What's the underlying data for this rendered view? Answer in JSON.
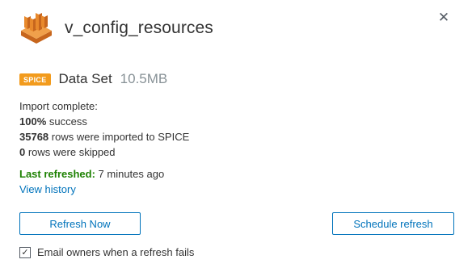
{
  "header": {
    "title": "v_config_resources",
    "close_symbol": "✕",
    "logo_icon": "quicksight-bars-icon",
    "logo_color": "#e8892c"
  },
  "dataset": {
    "badge": "SPICE",
    "badge_color": "#f29b1d",
    "label": "Data Set",
    "size": "10.5MB"
  },
  "status": {
    "import_line": "Import complete:",
    "success_value": "100%",
    "success_text": " success",
    "rows_imported_value": "35768",
    "rows_imported_text": " rows were imported to SPICE",
    "rows_skipped_value": "0",
    "rows_skipped_text": " rows were skipped"
  },
  "refresh": {
    "last_refreshed_label": "Last refreshed:",
    "last_refreshed_value": " 7 minutes ago",
    "view_history": "View history",
    "success_color": "#1d8102",
    "link_color": "#0073bb"
  },
  "actions": {
    "refresh_now": "Refresh Now",
    "schedule_refresh": "Schedule refresh"
  },
  "email_option": {
    "checked": true,
    "check_symbol": "✓",
    "label": "Email owners when a refresh fails"
  }
}
